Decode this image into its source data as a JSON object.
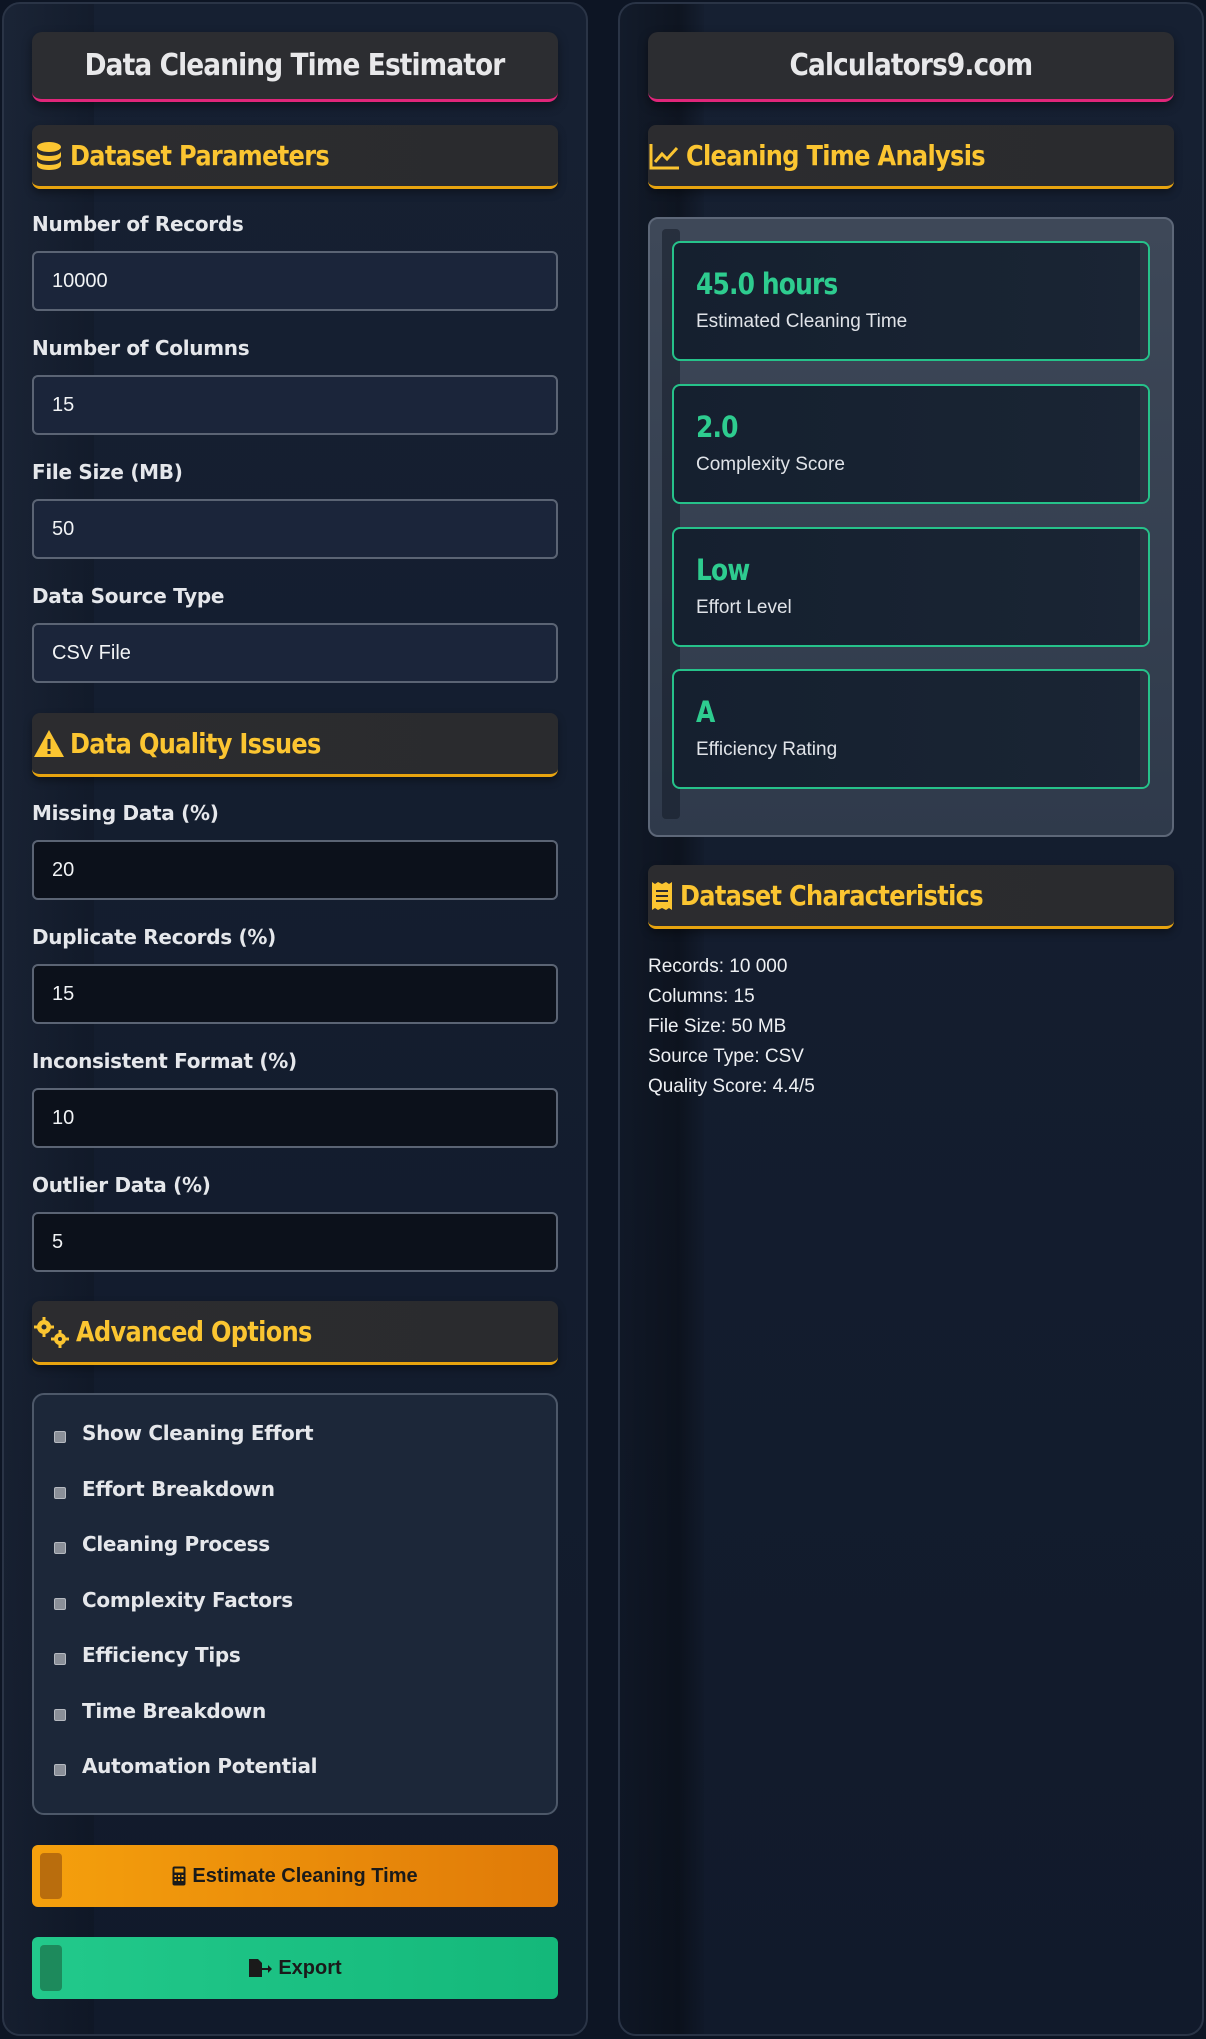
{
  "left": {
    "title": "Data Cleaning Time Estimator",
    "dataset_section": {
      "heading": "Dataset Parameters",
      "icon": "database-icon",
      "fields": [
        {
          "label": "Number of Records",
          "value": "10000"
        },
        {
          "label": "Number of Columns",
          "value": "15"
        },
        {
          "label": "File Size (MB)",
          "value": "50"
        },
        {
          "label": "Data Source Type",
          "value": "CSV File"
        }
      ]
    },
    "quality_section": {
      "heading": "Data Quality Issues",
      "icon": "warning-icon",
      "fields": [
        {
          "label": "Missing Data (%)",
          "value": "20"
        },
        {
          "label": "Duplicate Records (%)",
          "value": "15"
        },
        {
          "label": "Inconsistent Format (%)",
          "value": "10"
        },
        {
          "label": "Outlier Data (%)",
          "value": "5"
        }
      ]
    },
    "advanced_section": {
      "heading": "Advanced Options",
      "icon": "gears-icon",
      "options": [
        "Show Cleaning Effort",
        "Effort Breakdown",
        "Cleaning Process",
        "Complexity Factors",
        "Efficiency Tips",
        "Time Breakdown",
        "Automation Potential"
      ]
    },
    "buttons": {
      "estimate": "Estimate Cleaning Time",
      "export": "Export"
    }
  },
  "right": {
    "title": "Calculators9.com",
    "analysis_section": {
      "heading": "Cleaning Time Analysis",
      "icon": "line-chart-icon",
      "cards": [
        {
          "value": "45.0 hours",
          "caption": "Estimated Cleaning Time"
        },
        {
          "value": "2.0",
          "caption": "Complexity Score"
        },
        {
          "value": "Low",
          "caption": "Effort Level"
        },
        {
          "value": "A",
          "caption": "Efficiency Rating"
        }
      ]
    },
    "characteristics_section": {
      "heading": "Dataset Characteristics",
      "icon": "receipt-icon",
      "lines": [
        "Records: 10 000",
        "Columns: 15",
        "File Size: 50 MB",
        "Source Type: CSV",
        "Quality Score: 4.4/5"
      ]
    }
  },
  "colors": {
    "accent_gold": "#fbc531",
    "accent_pink": "#e0267a",
    "result_green": "#2ecc8f",
    "button_orange": "#f5a00d",
    "button_green": "#22c98b"
  }
}
